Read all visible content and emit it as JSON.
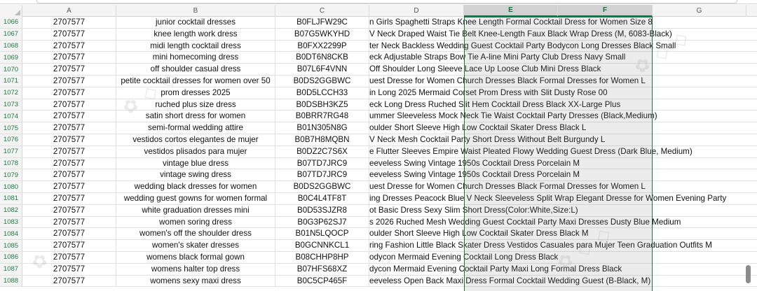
{
  "columns": [
    "A",
    "B",
    "C",
    "D",
    "E",
    "F",
    "G"
  ],
  "selected_columns": [
    "E",
    "F"
  ],
  "rows": [
    {
      "num": "1066",
      "a": "2707577",
      "b": "junior cocktail dresses",
      "c": "B0FLJFW29C",
      "d": "n Girls Spaghetti Straps Knee Length Formal Cocktail Dress for Women Size 8"
    },
    {
      "num": "1067",
      "a": "2707577",
      "b": "knee length work dress",
      "c": "B07G5WKYHD",
      "d": "V Neck Draped Waist Tie Belt Knee-Length Faux Black Wrap Dress (M, 6083-Black)"
    },
    {
      "num": "1068",
      "a": "2707577",
      "b": "midi length cocktail dress",
      "c": "B0FXX2299P",
      "d": "ter Neck Backless Wedding Guest Cocktail Party Bodycon Long Dresses Black Small"
    },
    {
      "num": "1069",
      "a": "2707577",
      "b": "mini homecoming dress",
      "c": "B0DT6N8CKB",
      "d": "eck Adjustable Straps Bow Tie A-line Mini Party Club Dress Navy Small"
    },
    {
      "num": "1070",
      "a": "2707577",
      "b": "off shoulder casual dress",
      "c": "B07L6F4VNN",
      "d": "Off Shoulder Long Sleeve Lace Up Loose Club Mini Dress Black"
    },
    {
      "num": "1071",
      "a": "2707577",
      "b": "petite cocktail dresses for women over 50",
      "c": "B0DS2GGBWC",
      "d": "uest Dresse for Women Church Dresses Black Formal Dresses for Women L"
    },
    {
      "num": "1072",
      "a": "2707577",
      "b": "prom dresses 2025",
      "c": "B0D5LCCH33",
      "d": "in Long 2025 Mermaid Corset Prom Dress with Slit Dusty Rose 00"
    },
    {
      "num": "1073",
      "a": "2707577",
      "b": "ruched plus size dress",
      "c": "B0DSBH3KZ5",
      "d": "eck Long Dress Ruched Slit Hem Cocktail Dress Black XX-Large Plus"
    },
    {
      "num": "1074",
      "a": "2707577",
      "b": "satin short dress for women",
      "c": "B0BRR7RG48",
      "d": "ummer Sleeveless Mock Neck Tie Waist Cocktail Party Dresses (Black,Medium)"
    },
    {
      "num": "1075",
      "a": "2707577",
      "b": "semi-formal wedding attire",
      "c": "B01N305N8G",
      "d": "oulder Short Sleeve High Low Cocktail Skater Dress Black L"
    },
    {
      "num": "1076",
      "a": "2707577",
      "b": "vestidos cortos elegantes de mujer",
      "c": "B0B7H8MQBN",
      "d": "V Neck Mesh Cocktail Party Short Dress Without Belt Burgundy L"
    },
    {
      "num": "1077",
      "a": "2707577",
      "b": "vestidos plisados para mujer",
      "c": "B0DZ2C7S6X",
      "d": "e Flutter Sleeves Empire Waist Pleated Flowy Wedding Guest Dress (Dark Blue, Medium)"
    },
    {
      "num": "1078",
      "a": "2707577",
      "b": "vintage blue dress",
      "c": "B07TD7JRC9",
      "d": "eeveless Swing Vintage 1950s Cocktail Dress Porcelain M"
    },
    {
      "num": "1079",
      "a": "2707577",
      "b": "vintage swing dress",
      "c": "B07TD7JRC9",
      "d": "eeveless Swing Vintage 1950s Cocktail Dress Porcelain M"
    },
    {
      "num": "1080",
      "a": "2707577",
      "b": "wedding black dresses for women",
      "c": "B0DS2GGBWC",
      "d": "uest Dresse for Women Church Dresses Black Formal Dresses for Women L"
    },
    {
      "num": "1081",
      "a": "2707577",
      "b": "wedding guest gowns for women formal",
      "c": "B0C4L4TF8T",
      "d": "ing Dresses Peacock Blue V Neck Sleeveless Split Wrap Elegant Dresse for Women Evening Party"
    },
    {
      "num": "1082",
      "a": "2707577",
      "b": "white graduation dresses mini",
      "c": "B0D53SJZR8",
      "d": "ot Basic Dress Sexy Slim Short Dress(Color:White,Size:L)"
    },
    {
      "num": "1083",
      "a": "2707577",
      "b": "women soring dress",
      "c": "B0G3P62SJ7",
      "d": "s 2026 Ruched Mesh Wedding Guest Cocktail Party Maxi Dresses Dusty Blue Medium"
    },
    {
      "num": "1084",
      "a": "2707577",
      "b": "women's off the shoulder dress",
      "c": "B01N5LQOCP",
      "d": "oulder Short Sleeve High Low Cocktail Skater Dress Black M"
    },
    {
      "num": "1085",
      "a": "2707577",
      "b": "women's skater dresses",
      "c": "B0GCNNKCL1",
      "d": "ring Fashion Little Black Skater Dress Vestidos Casuales para Mujer Teen Graduation Outfits M"
    },
    {
      "num": "1086",
      "a": "2707577",
      "b": "womens black formal gown",
      "c": "B08CHHP8HP",
      "d": "odycon Mermaid Evening Cocktail Long Dress Black"
    },
    {
      "num": "1087",
      "a": "2707577",
      "b": "womens halter top dress",
      "c": "B07HFS68XZ",
      "d": "dycon Mermaid Evening Cocktail Party Maxi Long Formal Dress Black"
    },
    {
      "num": "1088",
      "a": "2707577",
      "b": "womens sexy maxi dress",
      "c": "B0C5CP465F",
      "d": "eeveless Open Back Maxi Dress Formal Cocktail Wedding Guest (B-Black, M)"
    }
  ]
}
